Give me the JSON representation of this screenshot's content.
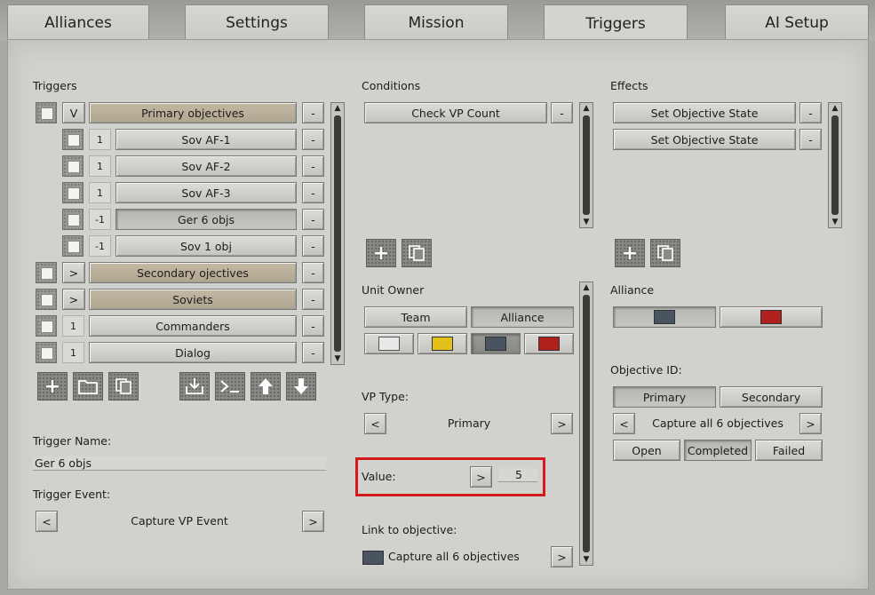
{
  "tabs": [
    "Alliances",
    "Settings",
    "Mission",
    "Triggers",
    "AI Setup"
  ],
  "triggers_section": {
    "title": "Triggers",
    "items": [
      {
        "toggle": "V",
        "label": "Primary objectives",
        "group": true
      },
      {
        "toggle": "1",
        "label": "Sov AF-1",
        "group": false
      },
      {
        "toggle": "1",
        "label": "Sov AF-2",
        "group": false
      },
      {
        "toggle": "1",
        "label": "Sov AF-3",
        "group": false
      },
      {
        "toggle": "-1",
        "label": "Ger 6 objs",
        "group": false
      },
      {
        "toggle": "-1",
        "label": "Sov 1 obj",
        "group": false
      },
      {
        "toggle": ">",
        "label": "Secondary ojectives",
        "group": true
      },
      {
        "toggle": ">",
        "label": "Soviets",
        "group": true
      },
      {
        "toggle": "1",
        "label": "Commanders",
        "group": false
      },
      {
        "toggle": "1",
        "label": "Dialog",
        "group": false
      }
    ],
    "minus": "-",
    "trigger_name_label": "Trigger Name:",
    "trigger_name_value": "Ger 6 objs",
    "trigger_event_label": "Trigger Event:",
    "trigger_event_value": "Capture VP Event"
  },
  "conditions": {
    "title": "Conditions",
    "items": [
      "Check VP Count"
    ],
    "unit_owner_label": "Unit Owner",
    "team": "Team",
    "alliance": "Alliance",
    "vp_type_label": "VP Type:",
    "vp_type_value": "Primary",
    "value_label": "Value:",
    "value": "5",
    "link_label": "Link to objective:",
    "link_value": "Capture all 6 objectives"
  },
  "effects": {
    "title": "Effects",
    "items": [
      "Set Objective State",
      "Set Objective State"
    ],
    "alliance_label": "Alliance",
    "objective_id_label": "Objective ID:",
    "primary": "Primary",
    "secondary": "Secondary",
    "objective_value": "Capture all 6 objectives",
    "open": "Open",
    "completed": "Completed",
    "failed": "Failed"
  },
  "arrows": {
    "left": "<",
    "right": ">"
  },
  "colors": {
    "white": "#e8e8e8",
    "yellow": "#e2c21a",
    "grey": "#4a5360",
    "red": "#b0201c"
  }
}
